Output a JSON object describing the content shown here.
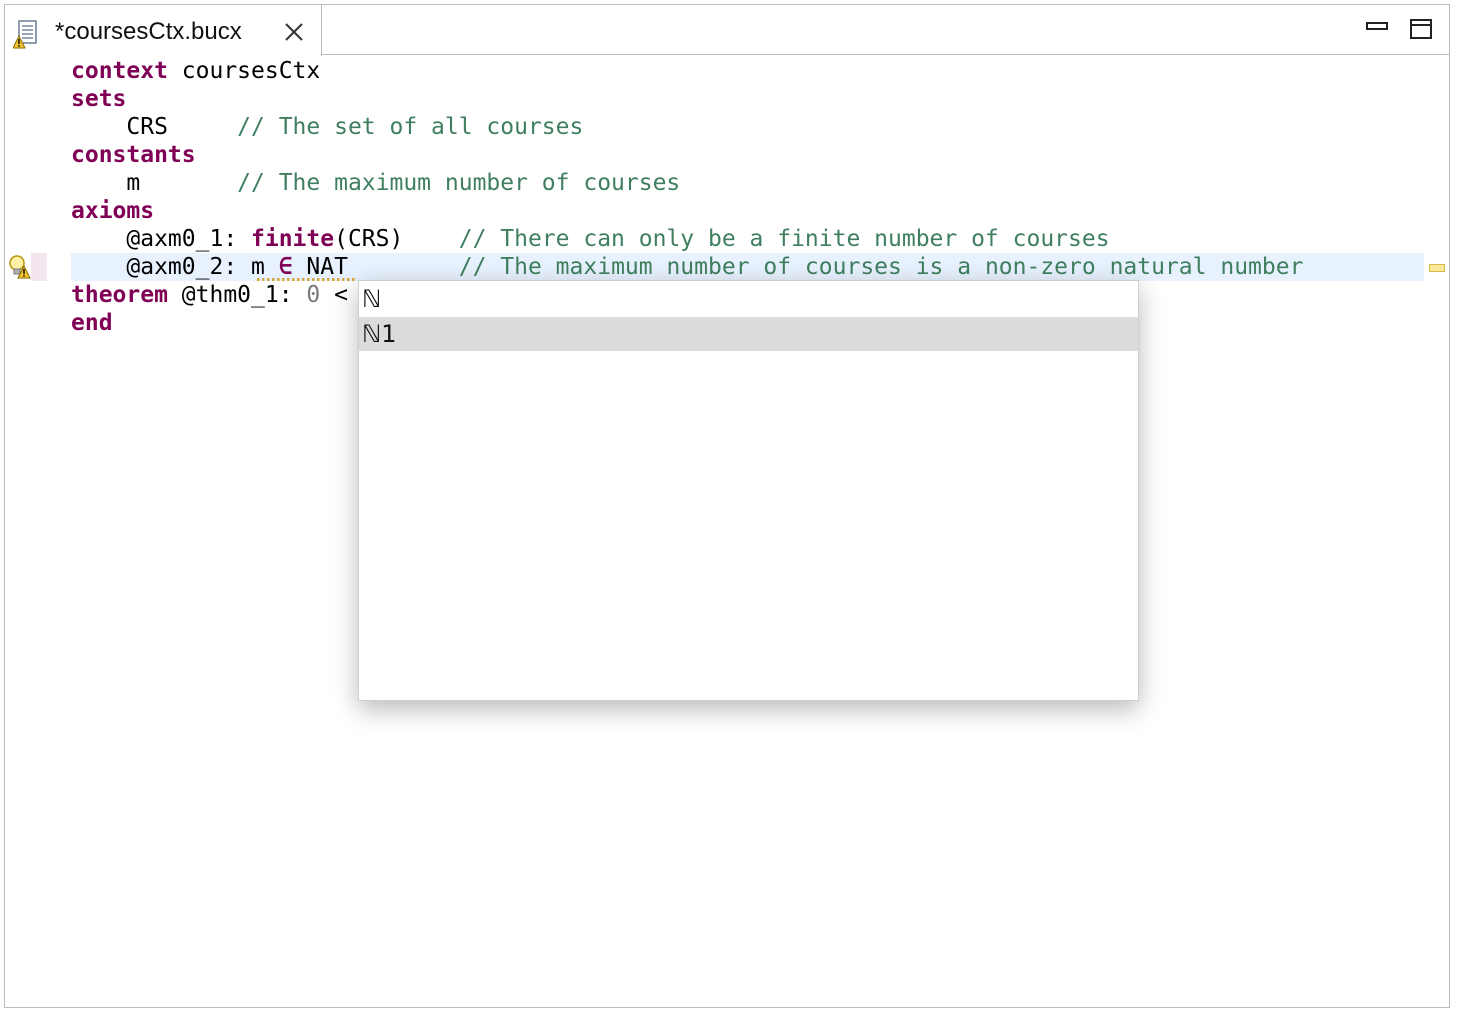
{
  "tab": {
    "title": "*coursesCtx.bucx",
    "icon": "context-file-warning-icon",
    "close_icon": "close-icon"
  },
  "window_controls": {
    "minimize_icon": "minimize-icon",
    "maximize_icon": "maximize-icon"
  },
  "editor": {
    "lines": [
      {
        "parts": [
          {
            "t": "context",
            "k": "kw"
          },
          {
            "t": " coursesCtx",
            "k": ""
          }
        ]
      },
      {
        "parts": [
          {
            "t": "sets",
            "k": "kw"
          }
        ]
      },
      {
        "parts": [
          {
            "t": "    CRS     ",
            "k": ""
          },
          {
            "t": "// The set of all courses",
            "k": "cm"
          }
        ]
      },
      {
        "parts": [
          {
            "t": "constants",
            "k": "kw"
          }
        ]
      },
      {
        "parts": [
          {
            "t": "    m       ",
            "k": ""
          },
          {
            "t": "// The maximum number of courses",
            "k": "cm"
          }
        ]
      },
      {
        "parts": [
          {
            "t": "axioms",
            "k": "kw"
          }
        ]
      },
      {
        "parts": [
          {
            "t": "    @axm0_1: ",
            "k": ""
          },
          {
            "t": "finite",
            "k": "kw"
          },
          {
            "t": "(CRS)    ",
            "k": ""
          },
          {
            "t": "// There can only be a finite number of courses",
            "k": "cm"
          }
        ]
      },
      {
        "parts": [
          {
            "t": "    @axm0_2: m ",
            "k": ""
          },
          {
            "t": "∈",
            "k": "kw"
          },
          {
            "t": " NAT        ",
            "k": ""
          },
          {
            "t": "// The maximum number of courses is a non-zero natural number",
            "k": "cm"
          }
        ]
      },
      {
        "parts": [
          {
            "t": "theorem",
            "k": "kw"
          },
          {
            "t": " @thm0_1: ",
            "k": ""
          },
          {
            "t": "0",
            "k": "num"
          },
          {
            "t": " <",
            "k": ""
          }
        ]
      },
      {
        "parts": [
          {
            "t": "end",
            "k": "kw"
          }
        ]
      }
    ],
    "gutter_icon": "warning-lightbulb-icon",
    "overview_marker": "warning-marker"
  },
  "autocomplete": {
    "items": [
      {
        "label": "ℕ",
        "selected": false
      },
      {
        "label": "ℕ1",
        "selected": true
      }
    ]
  },
  "colors": {
    "keyword": "#7f0055",
    "comment": "#3f7f5f",
    "current_line": "#e8f2fe",
    "selection": "#dcdcdc"
  }
}
